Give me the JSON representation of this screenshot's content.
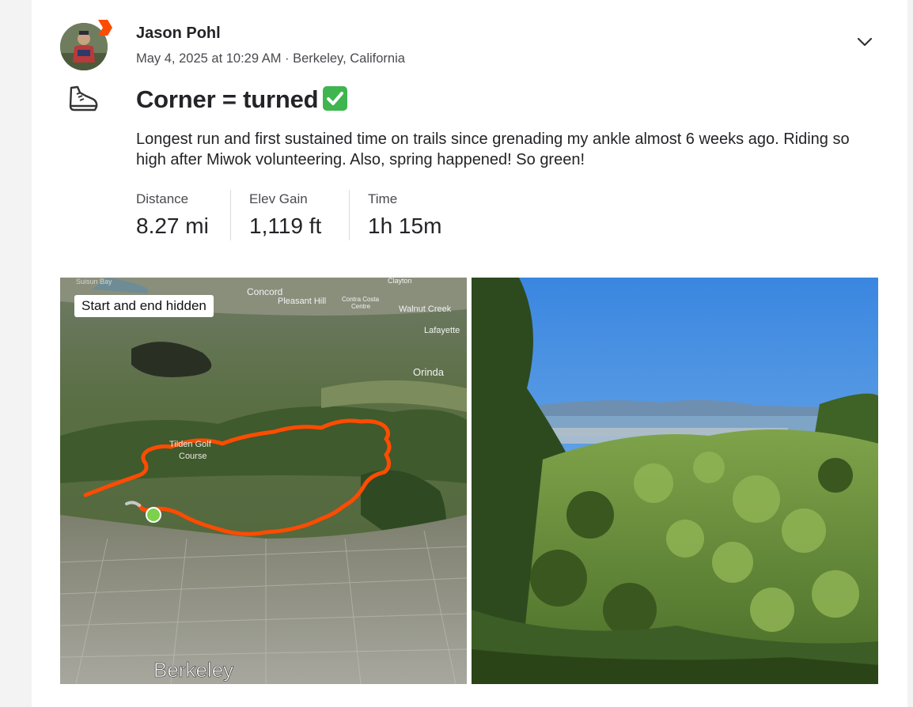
{
  "post": {
    "author": "Jason Pohl",
    "meta": "May 4, 2025 at 10:29 AM · Berkeley, California",
    "title": "Corner = turned",
    "description": "Longest run and first sustained time on trails since grenading my ankle almost 6 weeks ago. Riding so high after Miwok volunteering. Also, spring happened! So green!",
    "activity_icon": "running-shoe-icon",
    "accent_color": "#fc4c02"
  },
  "stats": [
    {
      "label": "Distance",
      "value": "8.27 mi"
    },
    {
      "label": "Elev Gain",
      "value": "1,119 ft"
    },
    {
      "label": "Time",
      "value": "1h 15m"
    }
  ],
  "map": {
    "privacy_label": "Start and end hidden",
    "places": {
      "suisun_bay": "Suisun Bay",
      "clayton": "Clayton",
      "concord": "Concord",
      "pleasant_hill": "Pleasant Hill",
      "contra_costa": "Contra Costa",
      "centre": "Centre",
      "walnut_creek": "Walnut Creek",
      "lafayette": "Lafayette",
      "orinda": "Orinda",
      "tilden": "Tilden Golf",
      "course": "Course",
      "berkeley": "Berkeley"
    }
  }
}
